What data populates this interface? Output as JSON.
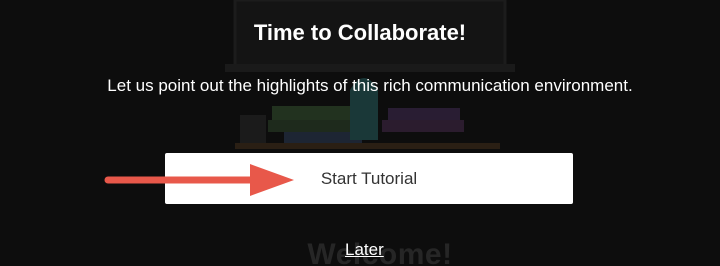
{
  "overlay": {
    "title": "Time to Collaborate!",
    "subtitle": "Let us point out the highlights of this rich communication environment.",
    "start_button_label": "Start Tutorial",
    "later_link_label": "Later"
  },
  "background": {
    "welcome_text": "Welcome!"
  },
  "colors": {
    "overlay_bg": "#0d0d0d",
    "button_bg": "#ffffff",
    "arrow": "#e8584a"
  },
  "icons": [
    "annotation-arrow-icon"
  ]
}
